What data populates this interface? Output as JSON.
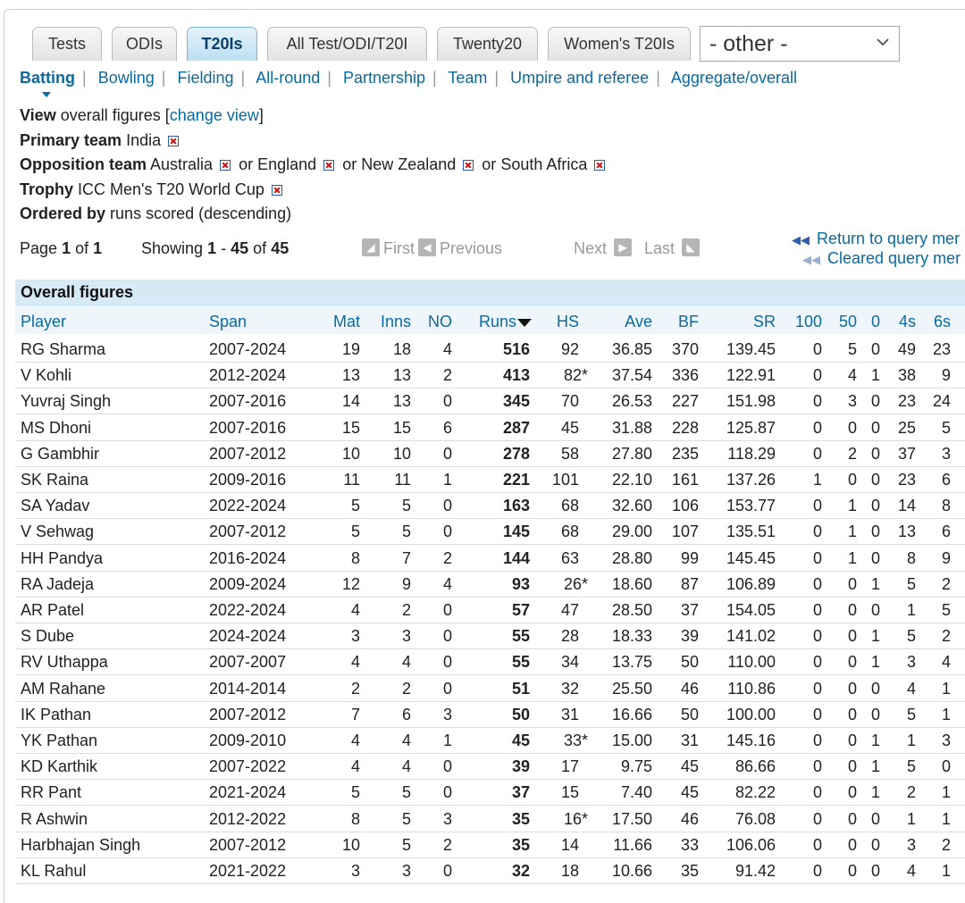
{
  "tabs": [
    {
      "label": "Tests",
      "active": false
    },
    {
      "label": "ODIs",
      "active": false
    },
    {
      "label": "T20Is",
      "active": true
    },
    {
      "label": "All Test/ODI/T20I",
      "active": false
    },
    {
      "label": "Twenty20",
      "active": false
    },
    {
      "label": "Women's T20Is",
      "active": false
    }
  ],
  "other_select": {
    "value": "- other -"
  },
  "subnav": [
    "Batting",
    "Bowling",
    "Fielding",
    "All-round",
    "Partnership",
    "Team",
    "Umpire and referee",
    "Aggregate/overall"
  ],
  "filters": {
    "view": {
      "label": "View",
      "text": "overall figures [",
      "link": "change view",
      "end": "]"
    },
    "primary": {
      "label": "Primary team",
      "value": "India"
    },
    "opposition": {
      "label": "Opposition team",
      "v1": "Australia",
      "or": "or",
      "v2": "England",
      "v3": "New Zealand",
      "v4": "South Africa"
    },
    "trophy": {
      "label": "Trophy",
      "value": "ICC Men's T20 World Cup"
    },
    "ordered": {
      "label": "Ordered by",
      "value": "runs scored (descending)"
    }
  },
  "pager": {
    "page_word": "Page",
    "page": "1",
    "of_word": "of",
    "pages": "1",
    "showing_word": "Showing",
    "from": "1",
    "dash": "-",
    "to": "45",
    "of2": "of",
    "total": "45",
    "first": "First",
    "previous": "Previous",
    "next": "Next",
    "last": "Last"
  },
  "return_links": {
    "query": "Return to query mer",
    "cleared": "Cleared query mer"
  },
  "table": {
    "title": "Overall figures",
    "columns": [
      "Player",
      "Span",
      "Mat",
      "Inns",
      "NO",
      "Runs",
      "HS",
      "Ave",
      "BF",
      "SR",
      "100",
      "50",
      "0",
      "4s",
      "6s"
    ],
    "rows": [
      [
        "RG Sharma",
        "2007-2024",
        "19",
        "18",
        "4",
        "516",
        "92",
        "36.85",
        "370",
        "139.45",
        "0",
        "5",
        "0",
        "49",
        "23"
      ],
      [
        "V Kohli",
        "2012-2024",
        "13",
        "13",
        "2",
        "413",
        "82*",
        "37.54",
        "336",
        "122.91",
        "0",
        "4",
        "1",
        "38",
        "9"
      ],
      [
        "Yuvraj Singh",
        "2007-2016",
        "14",
        "13",
        "0",
        "345",
        "70",
        "26.53",
        "227",
        "151.98",
        "0",
        "3",
        "0",
        "23",
        "24"
      ],
      [
        "MS Dhoni",
        "2007-2016",
        "15",
        "15",
        "6",
        "287",
        "45",
        "31.88",
        "228",
        "125.87",
        "0",
        "0",
        "0",
        "25",
        "5"
      ],
      [
        "G Gambhir",
        "2007-2012",
        "10",
        "10",
        "0",
        "278",
        "58",
        "27.80",
        "235",
        "118.29",
        "0",
        "2",
        "0",
        "37",
        "3"
      ],
      [
        "SK Raina",
        "2009-2016",
        "11",
        "11",
        "1",
        "221",
        "101",
        "22.10",
        "161",
        "137.26",
        "1",
        "0",
        "0",
        "23",
        "6"
      ],
      [
        "SA Yadav",
        "2022-2024",
        "5",
        "5",
        "0",
        "163",
        "68",
        "32.60",
        "106",
        "153.77",
        "0",
        "1",
        "0",
        "14",
        "8"
      ],
      [
        "V Sehwag",
        "2007-2012",
        "5",
        "5",
        "0",
        "145",
        "68",
        "29.00",
        "107",
        "135.51",
        "0",
        "1",
        "0",
        "13",
        "6"
      ],
      [
        "HH Pandya",
        "2016-2024",
        "8",
        "7",
        "2",
        "144",
        "63",
        "28.80",
        "99",
        "145.45",
        "0",
        "1",
        "0",
        "8",
        "9"
      ],
      [
        "RA Jadeja",
        "2009-2024",
        "12",
        "9",
        "4",
        "93",
        "26*",
        "18.60",
        "87",
        "106.89",
        "0",
        "0",
        "1",
        "5",
        "2"
      ],
      [
        "AR Patel",
        "2022-2024",
        "4",
        "2",
        "0",
        "57",
        "47",
        "28.50",
        "37",
        "154.05",
        "0",
        "0",
        "0",
        "1",
        "5"
      ],
      [
        "S Dube",
        "2024-2024",
        "3",
        "3",
        "0",
        "55",
        "28",
        "18.33",
        "39",
        "141.02",
        "0",
        "0",
        "1",
        "5",
        "2"
      ],
      [
        "RV Uthappa",
        "2007-2007",
        "4",
        "4",
        "0",
        "55",
        "34",
        "13.75",
        "50",
        "110.00",
        "0",
        "0",
        "1",
        "3",
        "4"
      ],
      [
        "AM Rahane",
        "2014-2014",
        "2",
        "2",
        "0",
        "51",
        "32",
        "25.50",
        "46",
        "110.86",
        "0",
        "0",
        "0",
        "4",
        "1"
      ],
      [
        "IK Pathan",
        "2007-2012",
        "7",
        "6",
        "3",
        "50",
        "31",
        "16.66",
        "50",
        "100.00",
        "0",
        "0",
        "0",
        "5",
        "1"
      ],
      [
        "YK Pathan",
        "2009-2010",
        "4",
        "4",
        "1",
        "45",
        "33*",
        "15.00",
        "31",
        "145.16",
        "0",
        "0",
        "1",
        "1",
        "3"
      ],
      [
        "KD Karthik",
        "2007-2022",
        "4",
        "4",
        "0",
        "39",
        "17",
        "9.75",
        "45",
        "86.66",
        "0",
        "0",
        "1",
        "5",
        "0"
      ],
      [
        "RR Pant",
        "2021-2024",
        "5",
        "5",
        "0",
        "37",
        "15",
        "7.40",
        "45",
        "82.22",
        "0",
        "0",
        "1",
        "2",
        "1"
      ],
      [
        "R Ashwin",
        "2012-2022",
        "8",
        "5",
        "3",
        "35",
        "16*",
        "17.50",
        "46",
        "76.08",
        "0",
        "0",
        "0",
        "1",
        "1"
      ],
      [
        "Harbhajan Singh",
        "2007-2012",
        "10",
        "5",
        "2",
        "35",
        "14",
        "11.66",
        "33",
        "106.06",
        "0",
        "0",
        "0",
        "3",
        "2"
      ],
      [
        "KL Rahul",
        "2021-2022",
        "3",
        "3",
        "0",
        "32",
        "18",
        "10.66",
        "35",
        "91.42",
        "0",
        "0",
        "0",
        "4",
        "1"
      ]
    ]
  }
}
